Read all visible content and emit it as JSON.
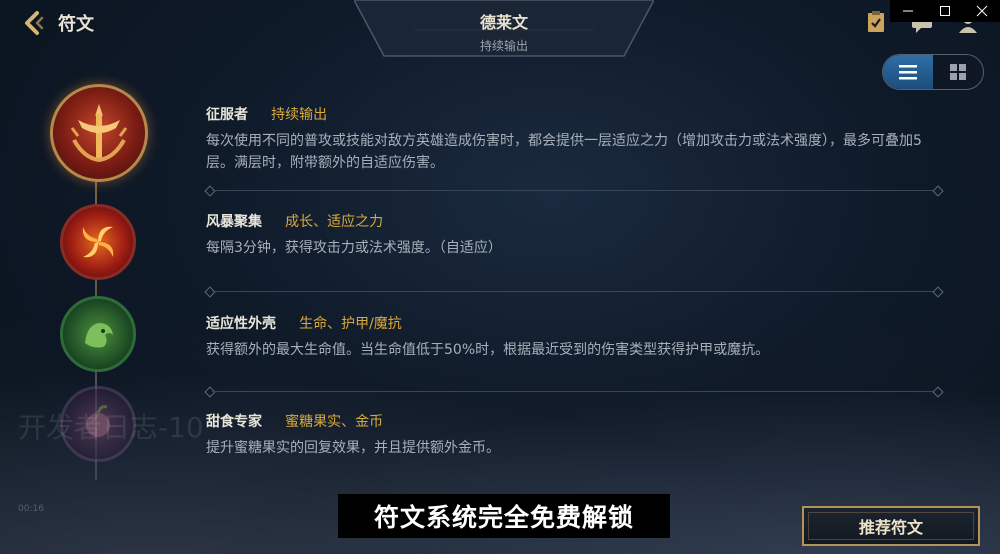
{
  "page": {
    "title": "符文"
  },
  "header": {
    "hero_name": "德莱文",
    "rune_page_name": "持续输出"
  },
  "view_toggle": {
    "active": "list"
  },
  "runes": [
    {
      "name": "征服者",
      "tags": "持续输出",
      "description": "每次使用不同的普攻或技能对敌方英雄造成伤害时，都会提供一层适应之力（增加攻击力或法术强度），最多可叠加5层。满层时，附带额外的自适应伤害。"
    },
    {
      "name": "风暴聚集",
      "tags": "成长、适应之力",
      "description": "每隔3分钟，获得攻击力或法术强度。（自适应）"
    },
    {
      "name": "适应性外壳",
      "tags": "生命、护甲/魔抗",
      "description": "获得额外的最大生命值。当生命值低于50%时，根据最近受到的伤害类型获得护甲或魔抗。"
    },
    {
      "name": "甜食专家",
      "tags": "蜜糖果实、金币",
      "description": "提升蜜糖果实的回复效果，并且提供额外金币。"
    }
  ],
  "overlay": {
    "watermark": "开发者日志-10",
    "timestamp": "00:16",
    "subtitle": "符文系统完全免费解锁"
  },
  "buttons": {
    "recommend": "推荐符文"
  },
  "colors": {
    "accent_gold": "#d9a93b",
    "toggle_active": "#2e6ea8"
  }
}
